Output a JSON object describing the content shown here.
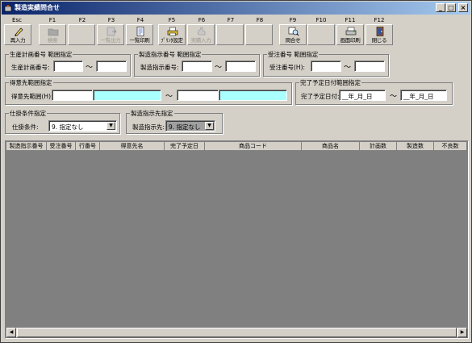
{
  "window": {
    "title": "製造実績問合せ",
    "controls": [
      "_",
      "□",
      "×"
    ]
  },
  "toolbar": {
    "fkeys": [
      "Esc",
      "F1",
      "F2",
      "F3",
      "F4",
      "F5",
      "F6",
      "F7",
      "F8",
      "F9",
      "F10",
      "F11",
      "F12"
    ],
    "buttons": {
      "esc": "再入力",
      "f1": "検索",
      "f3": "一覧出力",
      "f4": "一覧印刷",
      "f5": "ﾌﾟﾘﾝﾀ設定",
      "f6": "実績入力",
      "f9": "問合せ",
      "f11": "画面印刷",
      "f12": "閉じる"
    }
  },
  "filters": {
    "plan": {
      "title": "生産計画番号 範囲指定",
      "label": "生産計画番号:"
    },
    "order": {
      "title": "製造指示番号 範囲指定",
      "label": "製造指示番号:"
    },
    "receipt": {
      "title": "受注番号 範囲指定",
      "label": "受注番号(H):"
    },
    "customer": {
      "title": "得意先範囲指定",
      "label": "得意先範囲(H):"
    },
    "due": {
      "title": "完了予定日付範囲指定",
      "label": "完了予定日付:",
      "from": "__年_月_日",
      "to": "__年_月_日"
    },
    "spec": {
      "title": "仕掛条件指定",
      "label": "仕掛条件:",
      "value": "9. 指定なし"
    },
    "dest": {
      "title": "製造指示先指定",
      "label": "製造指示先:",
      "value": "9. 指定なし"
    },
    "tilde": "～"
  },
  "grid": {
    "columns": [
      "製造指示番号",
      "受注番号",
      "行番号",
      "得意先名",
      "完了予定日",
      "商品コード",
      "商品名",
      "計画数",
      "製造数",
      "不良数"
    ]
  },
  "colors": {
    "titlebar_start": "#0a246a",
    "titlebar_end": "#a6caf0",
    "field_cyan": "#aaffff",
    "grid_bg": "#808080"
  }
}
